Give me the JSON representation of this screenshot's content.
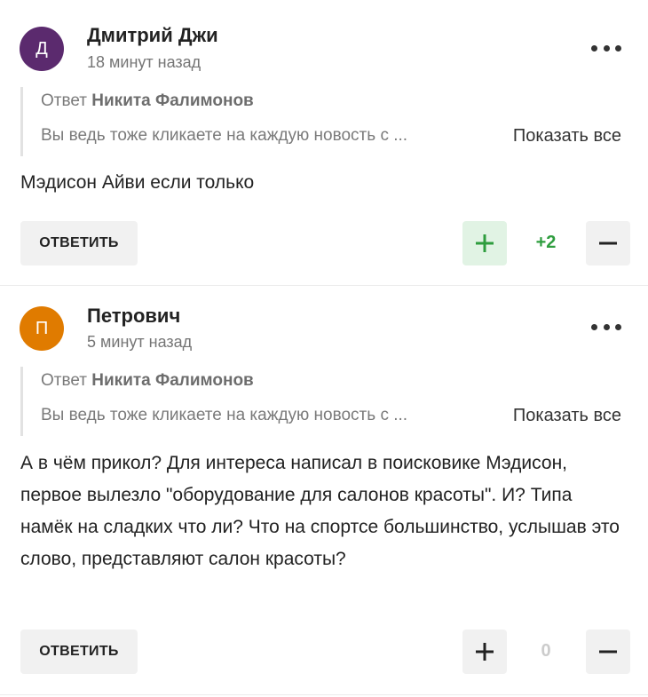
{
  "comments": [
    {
      "avatar_letter": "Д",
      "avatar_color": "#5b2a6e",
      "author": "Дмитрий Джи",
      "time": "18 минут назад",
      "reply_prefix": "Ответ",
      "reply_to": "Никита Фалимонов",
      "quote": "Вы ведь тоже кликаете на каждую новость с ...",
      "show_all": "Показать все",
      "text": "Мэдисон Айви если только",
      "reply_label": "ОТВЕТИТЬ",
      "votes": "+2",
      "votes_color": "#2e9d3e",
      "plus_active": true
    },
    {
      "avatar_letter": "П",
      "avatar_color": "#e07b00",
      "author": "Петрович",
      "time": "5 минут назад",
      "reply_prefix": "Ответ",
      "reply_to": "Никита Фалимонов",
      "quote": "Вы ведь тоже кликаете на каждую новость с ...",
      "show_all": "Показать все",
      "text": "А в чём прикол? Для интереса написал в поисковике Мэдисон, первое вылезло \"оборудование для салонов красоты\". И? Типа намёк на сладких что ли? Что на спортсе большинство, услышав это слово, представляют салон красоты?",
      "reply_label": "ОТВЕТИТЬ",
      "votes": "0",
      "votes_color": "#cccccc",
      "plus_active": false
    }
  ],
  "colors": {
    "plus_active": "#2e9d3e",
    "plus_default": "#222222",
    "minus": "#222222"
  }
}
